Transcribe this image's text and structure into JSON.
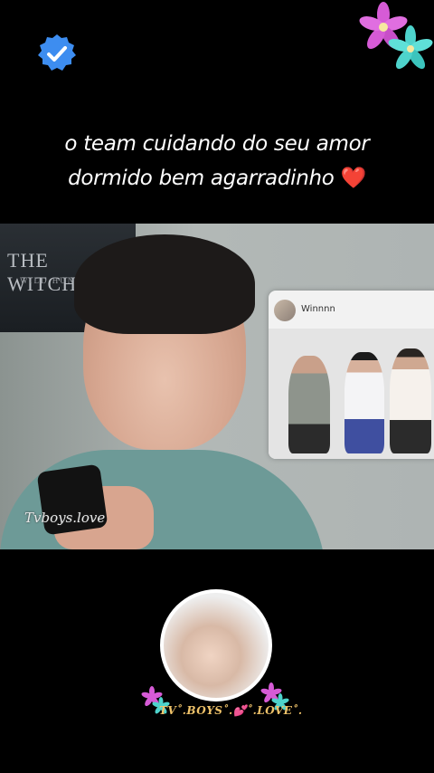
{
  "badge": {
    "icon": "verified-check-icon",
    "color": "#3d8df0"
  },
  "caption": {
    "line1": "o team cuidando do seu amor",
    "line2": "dormido bem agarradinho",
    "emoji": "❤️"
  },
  "video": {
    "poster_title": "THE WITCHER",
    "poster_subtitle": "WILD HUNT",
    "watermark": "Tvboys.love",
    "post_card": {
      "username": "Winnnn"
    }
  },
  "footer": {
    "brand": "TV˚.BOYS˚.💕˚.LOVE˚."
  }
}
